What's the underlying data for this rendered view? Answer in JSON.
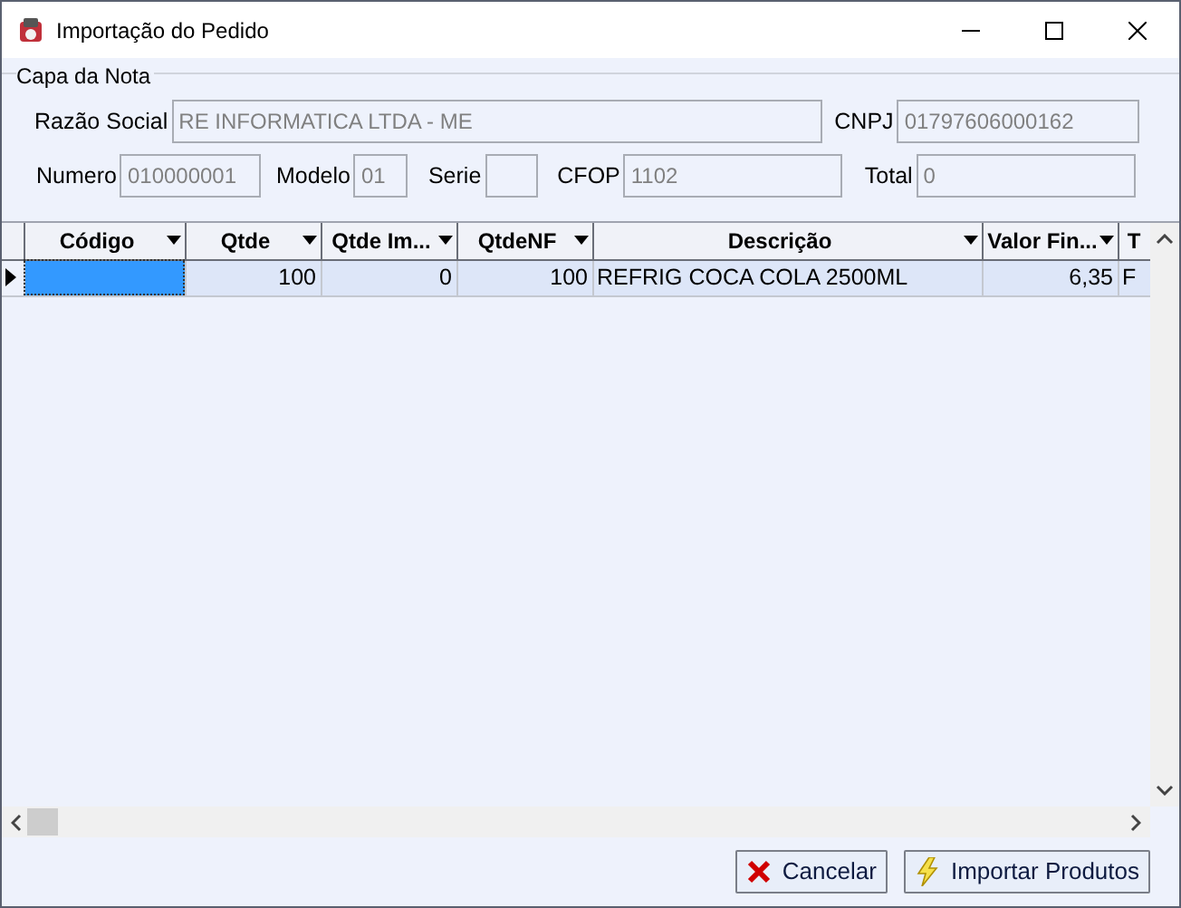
{
  "window": {
    "title": "Importação do Pedido"
  },
  "group": {
    "label": "Capa da Nota"
  },
  "field_rows": [
    [
      {
        "label": "Razão Social",
        "value": "RE INFORMATICA LTDA - ME"
      },
      {
        "label": "CNPJ",
        "value": "01797606000162"
      }
    ],
    [
      {
        "label": "Numero",
        "value": "010000001"
      },
      {
        "label": "Modelo",
        "value": "01"
      },
      {
        "label": "Serie"
      },
      {
        "label": "CFOP",
        "value": "1102"
      },
      {
        "label": "Total",
        "value": "0"
      }
    ]
  ],
  "grid": {
    "columns": [
      {
        "label": "Código",
        "kind": "text",
        "dropdown": true
      },
      {
        "label": "Qtde",
        "kind": "number",
        "dropdown": true
      },
      {
        "label": "Qtde Im...",
        "kind": "number",
        "dropdown": true
      },
      {
        "label": "QtdeNF",
        "kind": "number",
        "dropdown": true
      },
      {
        "label": "Descrição",
        "kind": "text",
        "dropdown": true
      },
      {
        "label": "Valor Fin...",
        "kind": "number",
        "dropdown": true
      },
      {
        "label": "T",
        "kind": "text",
        "dropdown": false
      }
    ],
    "rows": [
      {
        "current": true,
        "cells": [
          {
            "selected": true
          },
          {
            "text": "100",
            "selected": false
          },
          {
            "text": "0",
            "selected": false
          },
          {
            "text": "100",
            "selected": false
          },
          {
            "text": "REFRIG COCA COLA 2500ML",
            "selected": false
          },
          {
            "text": "6,35",
            "selected": false
          },
          {
            "text": "F",
            "selected": false
          }
        ]
      }
    ]
  },
  "buttons": [
    {
      "label": "Cancelar",
      "kind": "cancel"
    },
    {
      "label": "Importar Produtos",
      "kind": "import"
    }
  ]
}
